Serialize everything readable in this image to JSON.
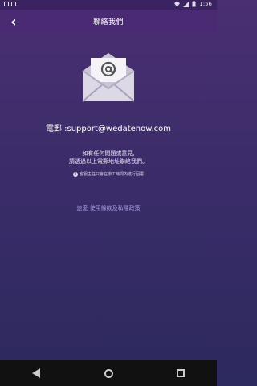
{
  "status_bar": {
    "time": "1:56"
  },
  "header": {
    "title": "聯絡我們",
    "back_symbol": "‹"
  },
  "contact": {
    "email_text": "電郵 :support@wedatenow.com",
    "note_line1": "如有任何問題或意見,",
    "note_line2": "請透過以上電郵地址聯絡我們。",
    "small_note": "客服主任只會在辦工時間內進行回覆"
  },
  "links": {
    "brand": "速愛",
    "terms": "使用條款及私隱政策"
  },
  "colors": {
    "bg_top": "#4a2f73",
    "bg_bottom": "#2c2a5e",
    "link": "#a9a0ea"
  },
  "icons": {
    "mail": "envelope-at-icon",
    "back": "chevron-left-icon",
    "info": "info-icon"
  }
}
